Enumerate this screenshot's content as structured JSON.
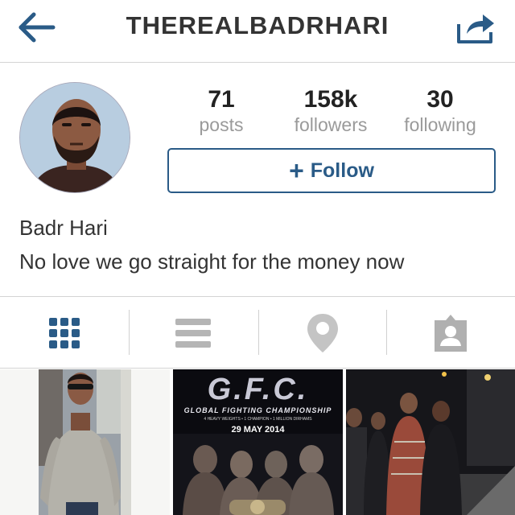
{
  "header": {
    "title": "THEREALBADRHARI",
    "back_icon": "back-arrow-icon",
    "share_icon": "share-icon",
    "accent": "#2a5b87"
  },
  "profile": {
    "stats": [
      {
        "value": "71",
        "label": "posts"
      },
      {
        "value": "158k",
        "label": "followers"
      },
      {
        "value": "30",
        "label": "following"
      }
    ],
    "follow_label": "Follow",
    "follow_icon": "+",
    "name": "Badr Hari",
    "bio": "No love we go straight for the money now"
  },
  "tabs": [
    {
      "icon": "grid-icon",
      "active": true
    },
    {
      "icon": "list-icon",
      "active": false
    },
    {
      "icon": "location-pin-icon",
      "active": false
    },
    {
      "icon": "tagged-person-icon",
      "active": false
    }
  ],
  "poster": {
    "logo": "G.F.C.",
    "subtitle": "GLOBAL FIGHTING CHAMPIONSHIP",
    "tagline": "4 HEAVY WEIGHTS • 1 CHAMPION • 1 MILLION DIRHAMS",
    "date": "29 MAY 2014"
  },
  "colors": {
    "active_tab": "#2a5b87",
    "inactive_tab": "#b5b5b5",
    "muted_text": "#9a9a9a"
  }
}
